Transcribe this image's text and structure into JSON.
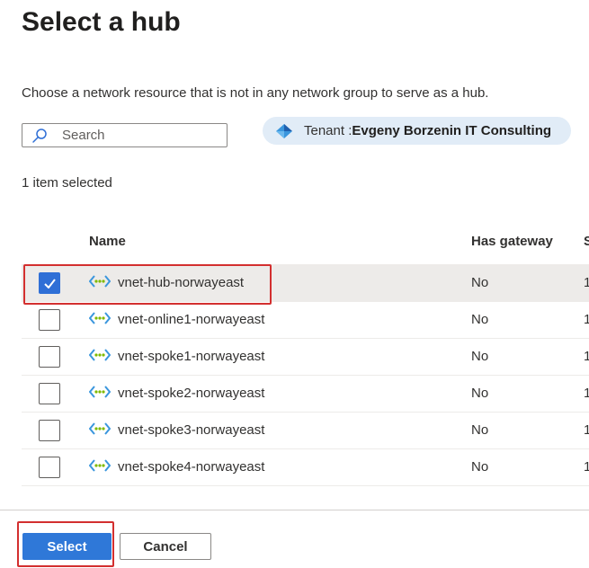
{
  "dialog": {
    "title": "Select a hub",
    "description": "Choose a network resource that is not in any network group to serve as a hub."
  },
  "search": {
    "placeholder": "Search",
    "value": ""
  },
  "tenant": {
    "label": "Tenant : ",
    "name": "Evgeny Borzenin IT Consulting"
  },
  "selection": {
    "count_text": "1 item selected"
  },
  "table": {
    "columns": [
      "Name",
      "Has gateway",
      "S"
    ],
    "rows": [
      {
        "name": "vnet-hub-norwayeast",
        "has_gateway": "No",
        "extra": "1",
        "checked": true
      },
      {
        "name": "vnet-online1-norwayeast",
        "has_gateway": "No",
        "extra": "1",
        "checked": false
      },
      {
        "name": "vnet-spoke1-norwayeast",
        "has_gateway": "No",
        "extra": "1",
        "checked": false
      },
      {
        "name": "vnet-spoke2-norwayeast",
        "has_gateway": "No",
        "extra": "1",
        "checked": false
      },
      {
        "name": "vnet-spoke3-norwayeast",
        "has_gateway": "No",
        "extra": "1",
        "checked": false
      },
      {
        "name": "vnet-spoke4-norwayeast",
        "has_gateway": "No",
        "extra": "1",
        "checked": false
      }
    ]
  },
  "footer": {
    "select_label": "Select",
    "cancel_label": "Cancel"
  },
  "colors": {
    "accent": "#2f78d8",
    "highlight": "#d32f2f",
    "selected_row": "#edebe9"
  },
  "icons": {
    "search": "search-icon",
    "tenant": "azure-tenant-icon",
    "vnet": "virtual-network-icon",
    "check": "checkmark-icon"
  }
}
